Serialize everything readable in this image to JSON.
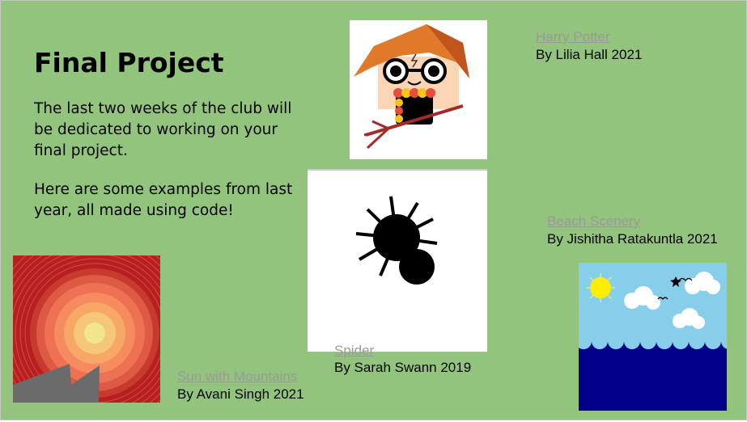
{
  "slide": {
    "title": "Final Project",
    "paragraphs": [
      "The last two weeks of the club will be dedicated to working on your final project.",
      "Here are some examples from last year, all made using code!"
    ]
  },
  "projects": [
    {
      "name": "Harry Potter",
      "byline": "By Lilia Hall 2021"
    },
    {
      "name": "Beach Scenery",
      "byline": "By Jishitha Ratakuntla 2021"
    },
    {
      "name": "Spider",
      "byline": "By Sarah Swann 2019"
    },
    {
      "name": "Sun with Mountains",
      "byline": "By Avani Singh 2021"
    }
  ],
  "colors": {
    "background": "#93c47d",
    "link": "#9a9a9a",
    "sea": "#00008b",
    "sky": "#87ceeb"
  }
}
